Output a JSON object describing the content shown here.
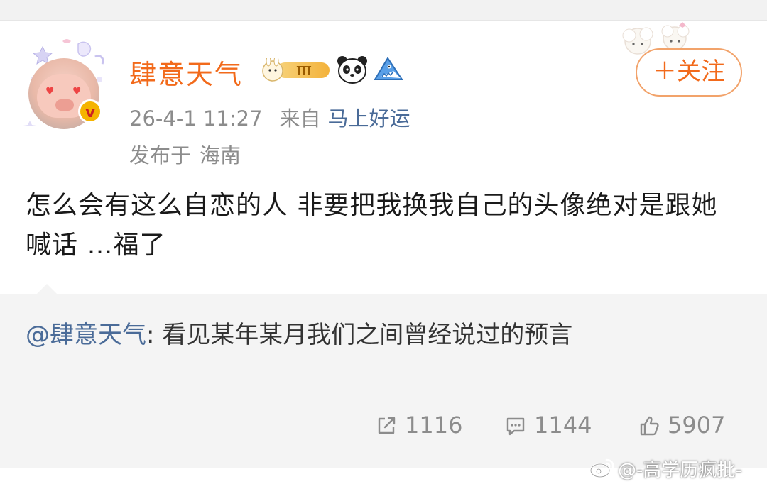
{
  "post": {
    "username": "肆意天气",
    "level": "Ⅲ",
    "timestamp": "26-4-1 11:27",
    "from_label": "来自",
    "source": "马上好运",
    "location_label": "发布于",
    "location": "海南",
    "follow_label": "＋关注",
    "text": "怎么会有这么自恋的人  非要把我换我自己的头像绝对是跟她喊话 …福了"
  },
  "repost": {
    "mention": "@肆意天气",
    "text": ": 看见某年某月我们之间曾经说过的预言"
  },
  "stats": {
    "shares": "1116",
    "comments": "1144",
    "likes": "5907"
  },
  "watermark": {
    "text": "@-高学历疯批-"
  },
  "colors": {
    "username": "#f26a1b",
    "link": "#4a6b98",
    "meta": "#8c8c8c",
    "repost_bg": "#f4f4f4"
  },
  "icons": [
    "verified-v-icon",
    "level-badge-icon",
    "panda-icon",
    "shark-icon",
    "share-icon",
    "comment-icon",
    "like-icon",
    "weibo-logo-icon"
  ]
}
